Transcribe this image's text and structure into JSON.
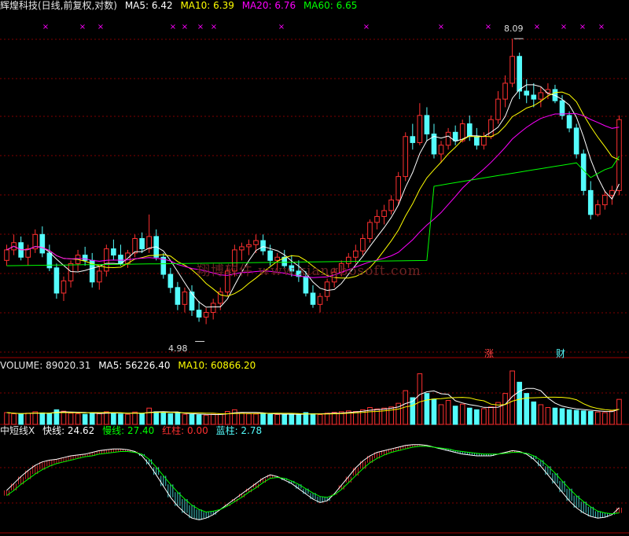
{
  "header": {
    "title": "辉煌科技(日线,前复权,对数)",
    "ma5": "MA5: 6.42",
    "ma10": "MA10: 6.39",
    "ma20": "MA20: 6.76",
    "ma60": "MA60: 6.65"
  },
  "volume_header": {
    "title": "VOLUME: 89020.31",
    "ma5": "MA5: 56226.40",
    "ma10": "MA10: 60866.20"
  },
  "osc_header": {
    "title": "中短线X",
    "fast": "快线: 24.62",
    "slow": "慢线: 27.40",
    "red": "红柱: 0.00",
    "blue": "蓝柱: 2.78"
  },
  "annotations": {
    "high_label": "8.09",
    "low_label": "4.98",
    "tag_zhang": "涨",
    "tag_cai": "财",
    "watermark": "翔博软件 www.xiangbosoft.com"
  },
  "colors": {
    "up": "#ff3030",
    "down": "#54fcfc",
    "ma5": "#ffffff",
    "ma10": "#ffff00",
    "ma20": "#ff00ff",
    "ma60": "#00ff00",
    "grid": "#800000",
    "marker": "#ff00ff"
  },
  "chart_data": [
    {
      "type": "candlestick",
      "title": "辉煌科技(日线,前复权,对数)",
      "high_marked": 8.09,
      "low_marked": 4.98,
      "ylim": [
        4.8,
        8.3
      ],
      "ohlc": [
        [
          5.55,
          5.7,
          5.5,
          5.65
        ],
        [
          5.65,
          5.8,
          5.6,
          5.72
        ],
        [
          5.72,
          5.78,
          5.55,
          5.58
        ],
        [
          5.58,
          5.7,
          5.5,
          5.66
        ],
        [
          5.66,
          5.85,
          5.62,
          5.8
        ],
        [
          5.8,
          5.88,
          5.58,
          5.62
        ],
        [
          5.62,
          5.7,
          5.45,
          5.48
        ],
        [
          5.48,
          5.52,
          5.2,
          5.25
        ],
        [
          5.25,
          5.4,
          5.18,
          5.36
        ],
        [
          5.36,
          5.55,
          5.3,
          5.52
        ],
        [
          5.52,
          5.65,
          5.45,
          5.6
        ],
        [
          5.6,
          5.68,
          5.5,
          5.55
        ],
        [
          5.55,
          5.62,
          5.3,
          5.35
        ],
        [
          5.35,
          5.5,
          5.28,
          5.45
        ],
        [
          5.45,
          5.7,
          5.4,
          5.66
        ],
        [
          5.66,
          5.75,
          5.55,
          5.6
        ],
        [
          5.6,
          5.7,
          5.5,
          5.52
        ],
        [
          5.52,
          5.65,
          5.48,
          5.62
        ],
        [
          5.62,
          5.8,
          5.58,
          5.76
        ],
        [
          5.76,
          5.82,
          5.62,
          5.66
        ],
        [
          5.66,
          6.0,
          5.62,
          5.78
        ],
        [
          5.78,
          5.85,
          5.55,
          5.58
        ],
        [
          5.58,
          5.62,
          5.38,
          5.42
        ],
        [
          5.42,
          5.48,
          5.25,
          5.3
        ],
        [
          5.3,
          5.35,
          5.1,
          5.15
        ],
        [
          5.15,
          5.3,
          5.08,
          5.26
        ],
        [
          5.26,
          5.32,
          5.05,
          5.1
        ],
        [
          5.1,
          5.18,
          5.0,
          5.04
        ],
        [
          5.04,
          5.12,
          4.98,
          5.08
        ],
        [
          5.08,
          5.2,
          5.02,
          5.16
        ],
        [
          5.16,
          5.3,
          5.1,
          5.26
        ],
        [
          5.26,
          5.5,
          5.22,
          5.45
        ],
        [
          5.45,
          5.7,
          5.4,
          5.65
        ],
        [
          5.65,
          5.72,
          5.55,
          5.68
        ],
        [
          5.68,
          5.75,
          5.6,
          5.7
        ],
        [
          5.7,
          5.8,
          5.62,
          5.74
        ],
        [
          5.74,
          5.8,
          5.6,
          5.64
        ],
        [
          5.64,
          5.7,
          5.5,
          5.55
        ],
        [
          5.55,
          5.62,
          5.45,
          5.58
        ],
        [
          5.58,
          5.65,
          5.48,
          5.5
        ],
        [
          5.5,
          5.6,
          5.4,
          5.45
        ],
        [
          5.45,
          5.55,
          5.35,
          5.4
        ],
        [
          5.4,
          5.45,
          5.22,
          5.25
        ],
        [
          5.25,
          5.32,
          5.12,
          5.15
        ],
        [
          5.15,
          5.25,
          5.08,
          5.22
        ],
        [
          5.22,
          5.38,
          5.18,
          5.35
        ],
        [
          5.35,
          5.48,
          5.3,
          5.44
        ],
        [
          5.44,
          5.55,
          5.4,
          5.52
        ],
        [
          5.52,
          5.62,
          5.48,
          5.58
        ],
        [
          5.58,
          5.7,
          5.52,
          5.64
        ],
        [
          5.64,
          5.8,
          5.6,
          5.76
        ],
        [
          5.76,
          5.95,
          5.72,
          5.92
        ],
        [
          5.92,
          6.05,
          5.85,
          5.98
        ],
        [
          5.98,
          6.1,
          5.9,
          6.04
        ],
        [
          6.04,
          6.2,
          6.0,
          6.15
        ],
        [
          6.15,
          6.45,
          6.1,
          6.4
        ],
        [
          6.4,
          6.9,
          6.35,
          6.85
        ],
        [
          6.85,
          7.0,
          6.7,
          6.78
        ],
        [
          6.78,
          7.25,
          6.75,
          7.1
        ],
        [
          7.1,
          7.2,
          6.8,
          6.88
        ],
        [
          6.88,
          7.0,
          6.6,
          6.65
        ],
        [
          6.65,
          6.8,
          6.55,
          6.75
        ],
        [
          6.75,
          6.95,
          6.7,
          6.9
        ],
        [
          6.9,
          6.98,
          6.75,
          6.8
        ],
        [
          6.8,
          7.05,
          6.78,
          7.0
        ],
        [
          7.0,
          7.1,
          6.8,
          6.85
        ],
        [
          6.85,
          6.95,
          6.7,
          6.75
        ],
        [
          6.75,
          6.9,
          6.7,
          6.85
        ],
        [
          6.85,
          7.1,
          6.82,
          7.05
        ],
        [
          7.05,
          7.4,
          7.0,
          7.3
        ],
        [
          7.3,
          7.6,
          7.2,
          7.5
        ],
        [
          7.5,
          8.09,
          7.45,
          7.85
        ],
        [
          7.85,
          7.9,
          7.3,
          7.4
        ],
        [
          7.4,
          7.55,
          7.25,
          7.35
        ],
        [
          7.35,
          7.5,
          7.2,
          7.3
        ],
        [
          7.3,
          7.45,
          7.2,
          7.38
        ],
        [
          7.38,
          7.5,
          7.3,
          7.42
        ],
        [
          7.42,
          7.48,
          7.25,
          7.28
        ],
        [
          7.28,
          7.35,
          7.05,
          7.1
        ],
        [
          7.1,
          7.15,
          6.9,
          6.95
        ],
        [
          6.95,
          7.0,
          6.6,
          6.65
        ],
        [
          6.65,
          6.7,
          6.2,
          6.25
        ],
        [
          6.25,
          6.35,
          5.95,
          6.0
        ],
        [
          6.0,
          6.15,
          5.98,
          6.1
        ],
        [
          6.1,
          6.25,
          6.05,
          6.2
        ],
        [
          6.2,
          6.3,
          6.1,
          6.25
        ],
        [
          6.25,
          7.1,
          6.2,
          7.05
        ]
      ],
      "ma_labels": [
        "MA5",
        "MA10",
        "MA20",
        "MA60"
      ]
    },
    {
      "type": "bar",
      "title": "VOLUME",
      "values": [
        42000,
        38000,
        36000,
        40000,
        45000,
        41000,
        39000,
        52000,
        47000,
        40000,
        38000,
        36000,
        42000,
        38000,
        45000,
        41000,
        37000,
        36000,
        44000,
        39000,
        58000,
        45000,
        41000,
        38000,
        40000,
        36000,
        35000,
        34000,
        33000,
        36000,
        38000,
        46000,
        52000,
        40000,
        38000,
        37000,
        39000,
        36000,
        35000,
        34000,
        37000,
        36000,
        42000,
        38000,
        35000,
        40000,
        43000,
        45000,
        48000,
        46000,
        52000,
        60000,
        55000,
        58000,
        62000,
        75000,
        120000,
        95000,
        180000,
        110000,
        90000,
        70000,
        85000,
        65000,
        72000,
        58000,
        52000,
        56000,
        62000,
        78000,
        110000,
        190000,
        150000,
        110000,
        80000,
        70000,
        60000,
        58000,
        56000,
        52000,
        50000,
        48000,
        46000,
        44000,
        42000,
        48000,
        89020
      ],
      "ma_labels": [
        "MA5",
        "MA10"
      ]
    },
    {
      "type": "area",
      "title": "中短线X",
      "series_names": [
        "快线",
        "慢线"
      ],
      "fast": [
        40,
        48,
        56,
        63,
        69,
        73,
        75,
        76,
        78,
        80,
        81,
        82,
        84,
        86,
        87,
        88,
        88,
        87,
        85,
        80,
        70,
        58,
        45,
        32,
        22,
        14,
        8,
        6,
        8,
        12,
        18,
        24,
        30,
        36,
        42,
        48,
        54,
        58,
        56,
        52,
        48,
        42,
        36,
        30,
        26,
        28,
        36,
        46,
        56,
        66,
        74,
        80,
        84,
        86,
        88,
        90,
        92,
        93,
        93,
        92,
        90,
        88,
        86,
        84,
        82,
        81,
        80,
        80,
        80,
        82,
        84,
        86,
        85,
        82,
        76,
        68,
        58,
        48,
        38,
        28,
        20,
        14,
        10,
        8,
        9,
        12,
        20
      ],
      "slow": [
        34,
        40,
        47,
        53,
        59,
        64,
        68,
        71,
        73,
        75,
        77,
        79,
        80,
        82,
        83,
        84,
        85,
        85,
        84,
        82,
        76,
        67,
        57,
        47,
        38,
        30,
        23,
        18,
        15,
        16,
        18,
        22,
        27,
        32,
        38,
        43,
        49,
        54,
        55,
        54,
        51,
        47,
        42,
        37,
        33,
        32,
        35,
        41,
        49,
        57,
        65,
        72,
        77,
        81,
        84,
        86,
        88,
        90,
        91,
        91,
        90,
        89,
        88,
        86,
        85,
        84,
        83,
        82,
        82,
        82,
        83,
        84,
        84,
        83,
        80,
        75,
        68,
        60,
        51,
        42,
        34,
        27,
        21,
        16,
        14,
        13,
        14
      ]
    }
  ]
}
